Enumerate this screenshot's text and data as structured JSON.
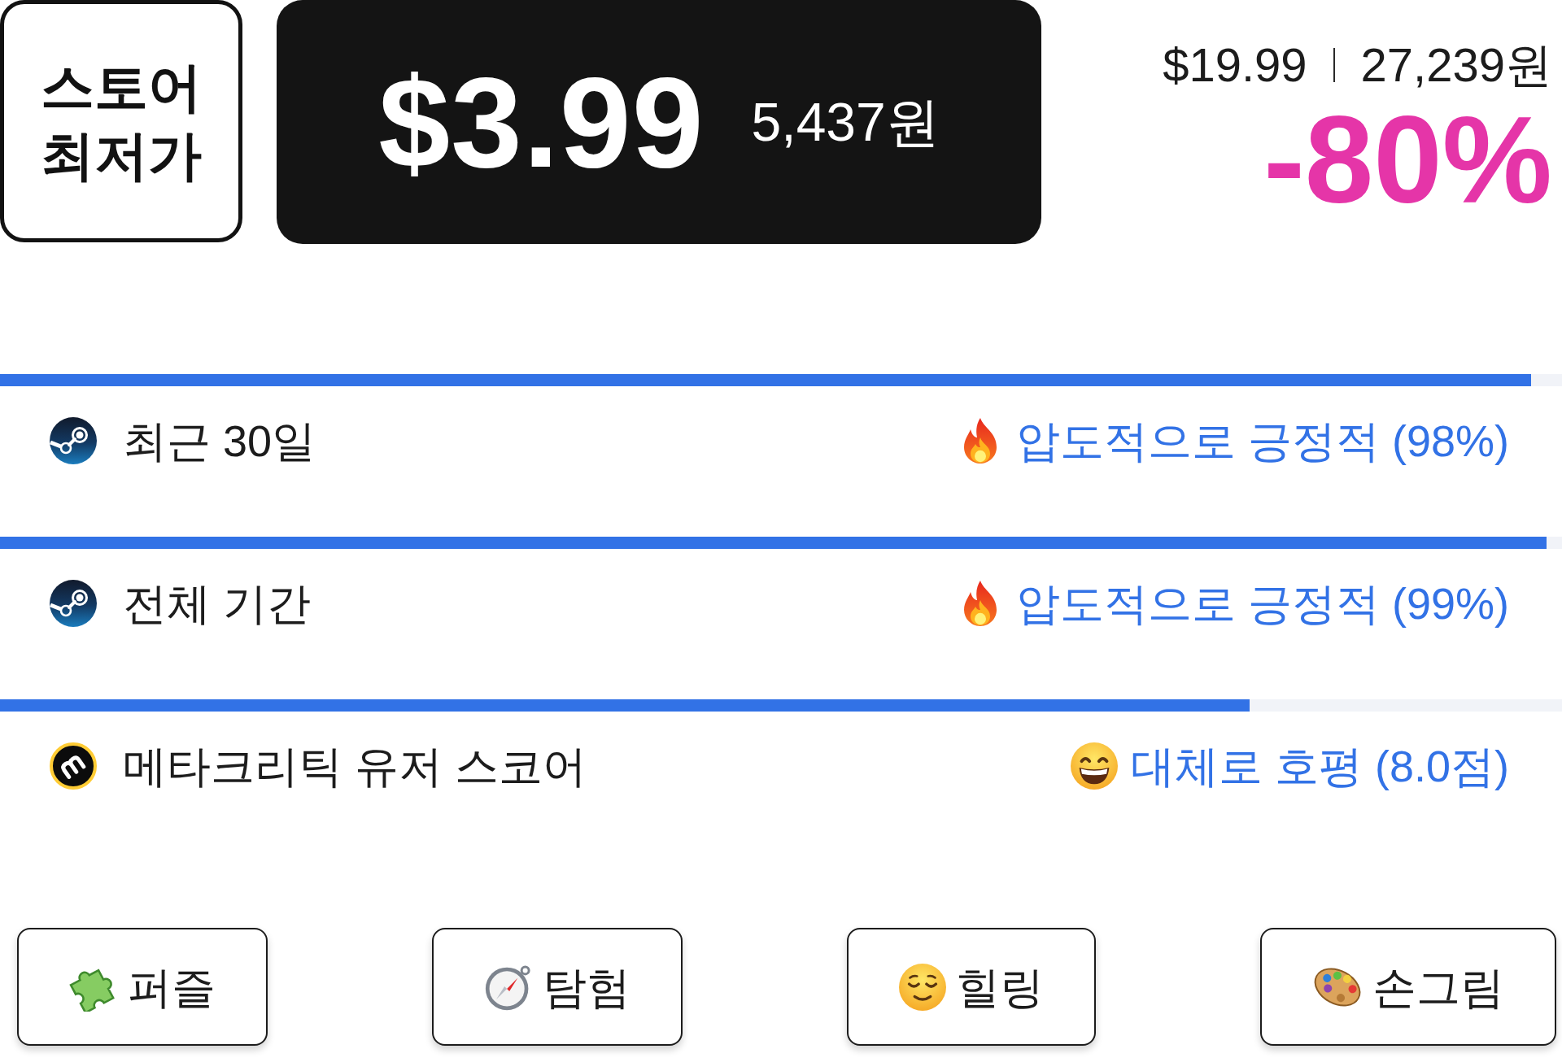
{
  "badge": {
    "label": "스토어 최저가"
  },
  "price": {
    "current": "$3.99",
    "current_krw": "5,437원",
    "original": "$19.99",
    "original_krw": "27,239원",
    "discount": "-80%"
  },
  "ratings": [
    {
      "kind": "steam",
      "level": 0.98,
      "label": "최근 30일",
      "rating": {
        "kind": "fire",
        "text": "압도적으로 긍정적 (98%)"
      }
    },
    {
      "kind": "steam",
      "level": 0.99,
      "label": "전체 기간",
      "rating": {
        "kind": "fire",
        "text": "압도적으로 긍정적 (99%)"
      }
    },
    {
      "kind": "metacritic",
      "level": 0.8,
      "label": "메타크리틱 유저 스코어",
      "rating": {
        "kind": "grin",
        "text": "대체로 호평 (8.0점)"
      }
    }
  ],
  "tags": [
    {
      "kind": "puzzle",
      "label": "퍼즐"
    },
    {
      "kind": "compass",
      "label": "탐험"
    },
    {
      "kind": "relieved",
      "label": "힐링"
    },
    {
      "kind": "palette",
      "label": "손그림"
    }
  ]
}
